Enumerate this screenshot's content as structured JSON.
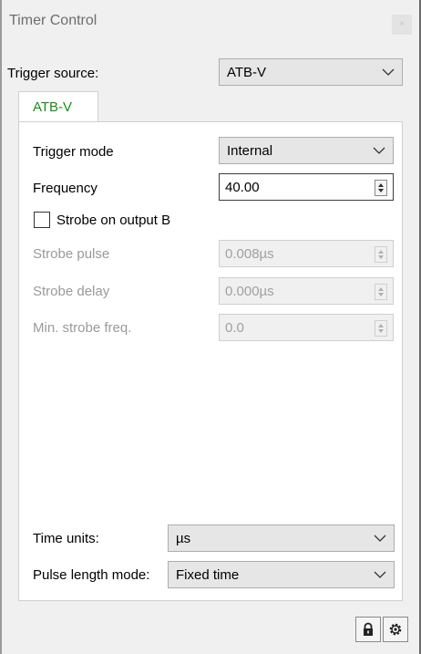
{
  "window": {
    "title": "Timer Control",
    "close_glyph": "×"
  },
  "trigger_source": {
    "label": "Trigger source:",
    "value": "ATB-V"
  },
  "tab": {
    "label": "ATB-V"
  },
  "trigger_mode": {
    "label": "Trigger mode",
    "value": "Internal"
  },
  "frequency": {
    "label": "Frequency",
    "value": "40.00"
  },
  "strobe_checkbox": {
    "label": "Strobe on output B",
    "checked": false
  },
  "strobe_pulse": {
    "label": "Strobe pulse",
    "value": "0.008µs"
  },
  "strobe_delay": {
    "label": "Strobe delay",
    "value": "0.000µs"
  },
  "min_strobe_freq": {
    "label": "Min. strobe freq.",
    "value": "0.0"
  },
  "time_units": {
    "label": "Time units:",
    "value": "µs"
  },
  "pulse_length_mode": {
    "label": "Pulse length mode:",
    "value": "Fixed time"
  },
  "icons": {
    "lock": "lock-icon",
    "settings": "gear-icon"
  },
  "colors": {
    "tab_text": "#1c8c1c",
    "disabled_text": "#9a9a9a"
  }
}
